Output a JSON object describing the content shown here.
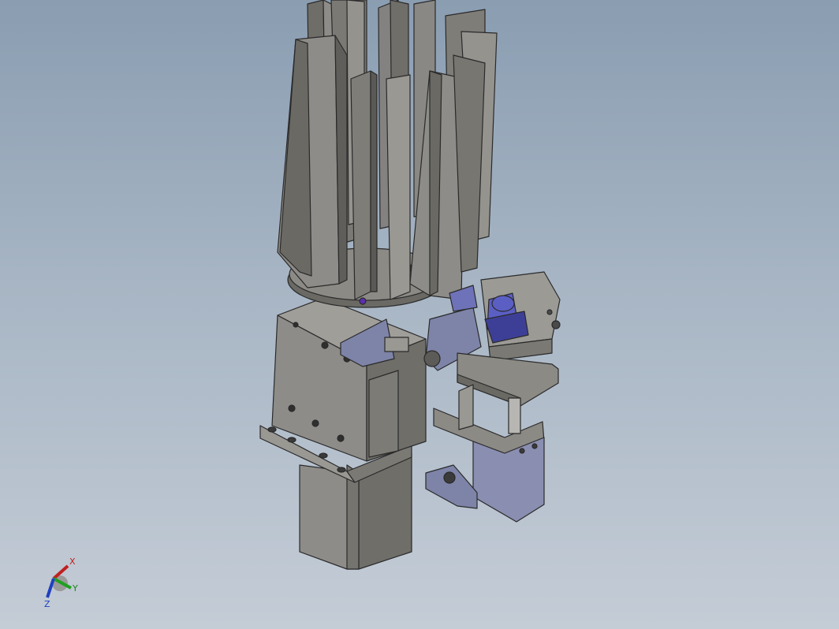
{
  "viewport": {
    "background_top": "#8a9db1",
    "background_bottom": "#c4ccd6"
  },
  "colors": {
    "metal_light": "#8e8c88",
    "metal_mid": "#75746f",
    "metal_dark": "#5c5b57",
    "edge": "#2a2a2a",
    "accent_blue": "#5b5fc4",
    "accent_blue_dark": "#3d3f96",
    "bracket_blue": "#7e84a8"
  },
  "triad": {
    "x_label": "X",
    "y_label": "Y",
    "z_label": "Z",
    "x_color": "#c02020",
    "y_color": "#20a020",
    "z_color": "#2040c0"
  }
}
